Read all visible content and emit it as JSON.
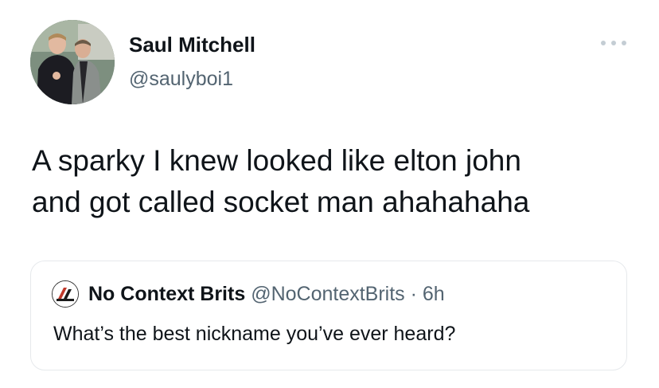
{
  "tweet": {
    "author": {
      "display_name": "Saul Mitchell",
      "handle": "@saulyboi1",
      "avatar_icon": "profile-photo-icon"
    },
    "menu_icon": "more-options-icon",
    "text_lines": [
      "A sparky I knew looked like elton john",
      "and got called socket man ahahahaha"
    ],
    "quote": {
      "avatar_icon": "quote-profile-photo-icon",
      "display_name": "No Context Brits",
      "handle": "@NoContextBrits",
      "separator": " · ",
      "time": "6h",
      "text": "What’s the best nickname you’ve ever heard?"
    }
  },
  "colors": {
    "text_primary": "#0f1419",
    "text_secondary": "#536471",
    "border": "#e6e9ec",
    "background": "#ffffff"
  }
}
